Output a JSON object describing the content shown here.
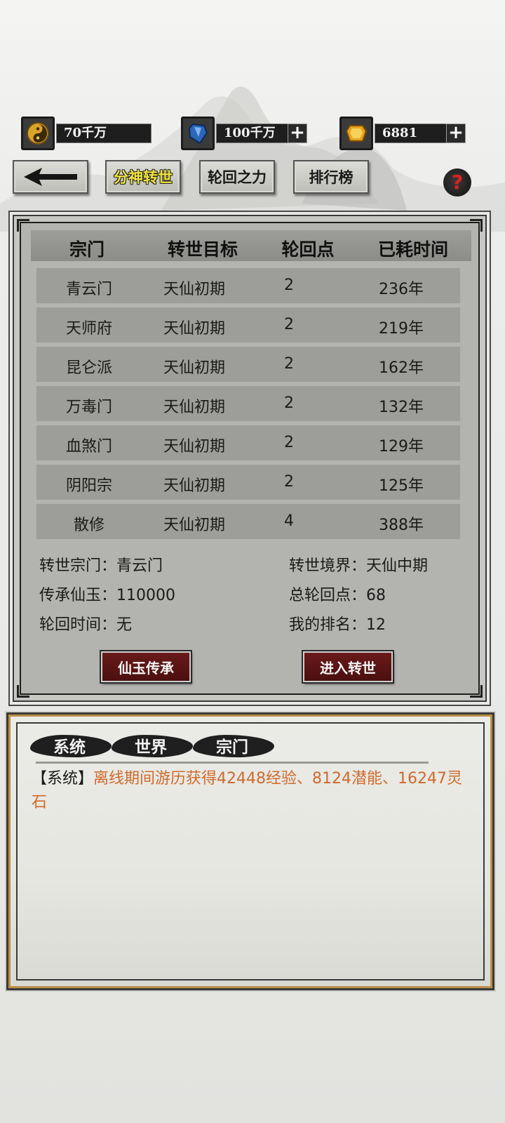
{
  "resources": [
    {
      "icon": "yin-yang-icon",
      "value": "70千万",
      "has_plus": false
    },
    {
      "icon": "blue-crystal-icon",
      "value": "100千万",
      "has_plus": true
    },
    {
      "icon": "gold-gem-icon",
      "value": "6881",
      "has_plus": true
    }
  ],
  "nav": {
    "back_icon": "arrow-left-icon",
    "tabs": [
      {
        "label": "分神转世",
        "active": true
      },
      {
        "label": "轮回之力",
        "active": false
      },
      {
        "label": "排行榜",
        "active": false
      }
    ],
    "help": "?"
  },
  "table": {
    "headers": [
      "宗门",
      "转世目标",
      "轮回点",
      "已耗时间"
    ],
    "rows": [
      {
        "sect": "青云门",
        "target": "天仙初期",
        "points": "2",
        "time": "236年"
      },
      {
        "sect": "天师府",
        "target": "天仙初期",
        "points": "2",
        "time": "219年"
      },
      {
        "sect": "昆仑派",
        "target": "天仙初期",
        "points": "2",
        "time": "162年"
      },
      {
        "sect": "万毒门",
        "target": "天仙初期",
        "points": "2",
        "time": "132年"
      },
      {
        "sect": "血煞门",
        "target": "天仙初期",
        "points": "2",
        "time": "129年"
      },
      {
        "sect": "阴阳宗",
        "target": "天仙初期",
        "points": "2",
        "time": "125年"
      },
      {
        "sect": "散修",
        "target": "天仙初期",
        "points": "4",
        "time": "388年"
      }
    ]
  },
  "info": {
    "reincarnation_sect": "转世宗门：青云门",
    "reincarnation_realm": "转世境界：天仙中期",
    "inherited_jade": "传承仙玉：110000",
    "total_points": "总轮回点：68",
    "reincarnation_time": "轮回时间：无",
    "my_rank": "我的排名：12"
  },
  "buttons": {
    "inherit": "仙玉传承",
    "enter": "进入转世"
  },
  "chat": {
    "tabs": [
      "系统",
      "世界",
      "宗门"
    ],
    "message_tag": "【系统】",
    "message_text": "离线期间游历获得42448经验、8124潜能、16247灵石"
  },
  "colors": {
    "chat_message": "#d06a2a",
    "chat_border": "#b88f47",
    "action_button": "#5a1414",
    "active_tab_text": "#f0e33a"
  }
}
